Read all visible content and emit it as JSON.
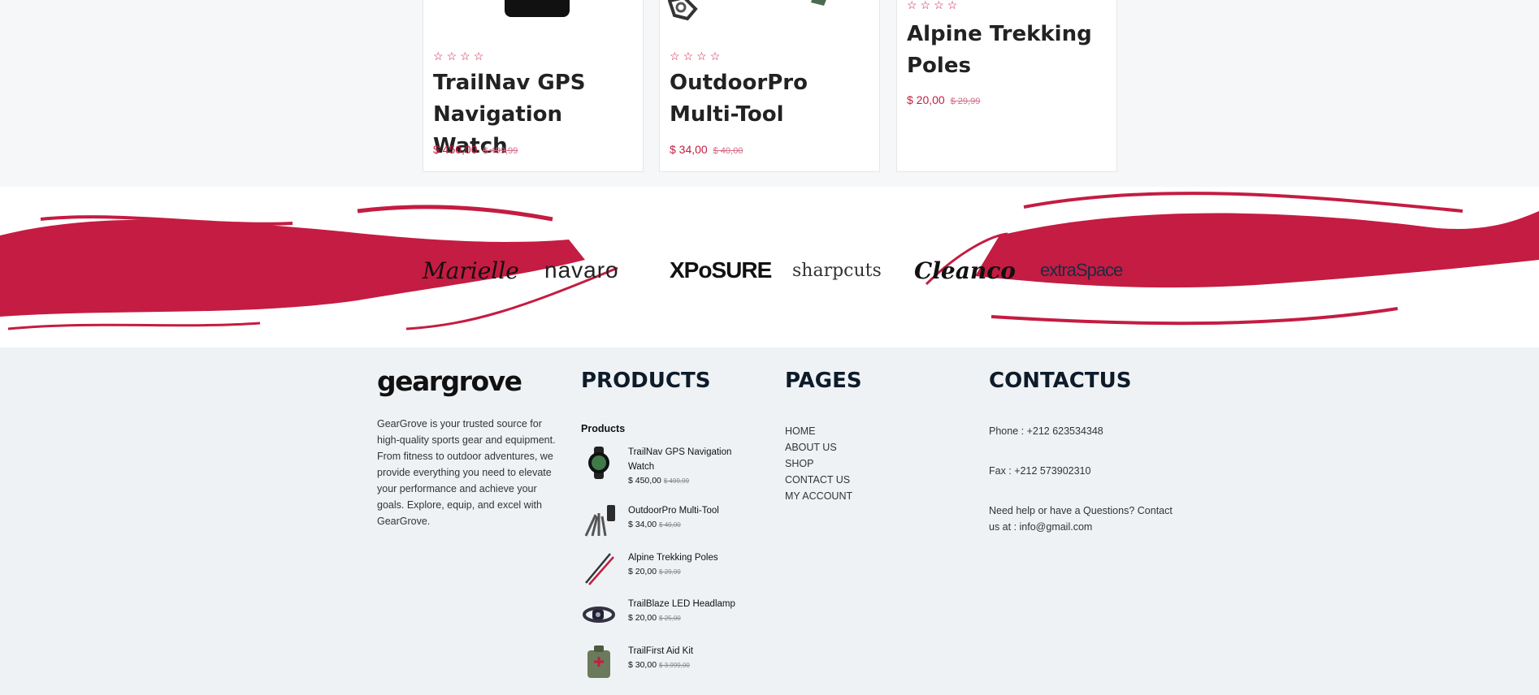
{
  "product_cards": [
    {
      "title": "TrailNav GPS Navigation Watch",
      "price": "$ 450,00",
      "old_price": "$ 499,99"
    },
    {
      "title": "OutdoorPro Multi-Tool",
      "price": "$ 34,00",
      "old_price": "$ 40,00"
    },
    {
      "title": "Alpine Trekking Poles",
      "price": "$ 20,00",
      "old_price": "$ 29,99"
    }
  ],
  "star_glyph": "☆",
  "brands": [
    "Marielle",
    "navaro",
    "XPoSURE",
    "sharpcuts",
    "Cleanco",
    "extraSpace"
  ],
  "colors": {
    "accent": "#c41c42",
    "footer_bg": "#eff2f5",
    "heading": "#0d1b2a"
  },
  "footer": {
    "logo_text": "geargrove",
    "about": "GearGrove is your trusted source for high-quality sports gear and equipment. From fitness to outdoor adventures, we provide everything you need to elevate your performance and achieve your goals. Explore, equip, and excel with GearGrove.",
    "products_heading": "PRODUCTS",
    "products_sub": "Products",
    "products": [
      {
        "name": "TrailNav GPS Navigation Watch",
        "price": "$ 450,00",
        "old_price": "$ 499,99",
        "icon": "watch-icon"
      },
      {
        "name": "OutdoorPro Multi-Tool",
        "price": "$ 34,00",
        "old_price": "$ 40,00",
        "icon": "multitool-icon"
      },
      {
        "name": "Alpine Trekking Poles",
        "price": "$ 20,00",
        "old_price": "$ 29,99",
        "icon": "poles-icon"
      },
      {
        "name": "TrailBlaze LED Headlamp",
        "price": "$ 20,00",
        "old_price": "$ 25,00",
        "icon": "headlamp-icon"
      },
      {
        "name": "TrailFirst Aid Kit",
        "price": "$ 30,00",
        "old_price": "$ 3.999,00",
        "icon": "aidkit-icon"
      }
    ],
    "pages_heading": "PAGES",
    "pages": [
      "HOME",
      "ABOUT US",
      "SHOP",
      "CONTACT US",
      "MY ACCOUNT"
    ],
    "contact_heading": "CONTACTUS",
    "phone": "Phone : +212 623534348",
    "fax": "Fax : +212 573902310",
    "help": "Need help or have a Questions? Contact us at : info@gmail.com"
  }
}
